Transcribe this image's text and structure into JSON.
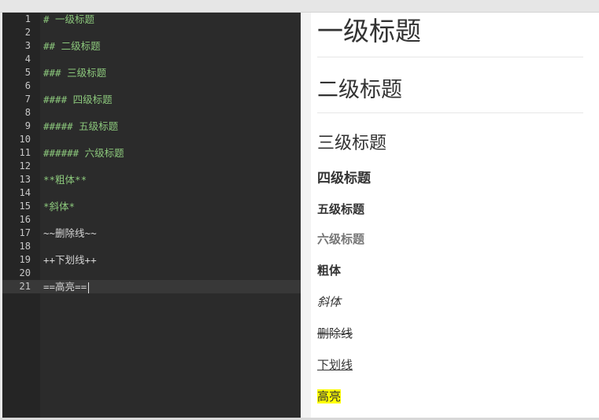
{
  "editor": {
    "lines": [
      {
        "n": "1",
        "text": "# 一级标题"
      },
      {
        "n": "2",
        "text": ""
      },
      {
        "n": "3",
        "text": "## 二级标题"
      },
      {
        "n": "4",
        "text": ""
      },
      {
        "n": "5",
        "text": "### 三级标题"
      },
      {
        "n": "6",
        "text": ""
      },
      {
        "n": "7",
        "text": "#### 四级标题"
      },
      {
        "n": "8",
        "text": ""
      },
      {
        "n": "9",
        "text": "##### 五级标题"
      },
      {
        "n": "10",
        "text": ""
      },
      {
        "n": "11",
        "text": "###### 六级标题"
      },
      {
        "n": "12",
        "text": ""
      },
      {
        "n": "13",
        "text": "**粗体**"
      },
      {
        "n": "14",
        "text": ""
      },
      {
        "n": "15",
        "text": "*斜体*"
      },
      {
        "n": "16",
        "text": ""
      },
      {
        "n": "17",
        "text": "~~删除线~~"
      },
      {
        "n": "18",
        "text": ""
      },
      {
        "n": "19",
        "text": "++下划线++"
      },
      {
        "n": "20",
        "text": ""
      },
      {
        "n": "21",
        "text": "==高亮=="
      }
    ],
    "active_line": "21"
  },
  "preview": {
    "h1": "一级标题",
    "h2": "二级标题",
    "h3": "三级标题",
    "h4": "四级标题",
    "h5": "五级标题",
    "h6": "六级标题",
    "bold": "粗体",
    "italic": "斜体",
    "strike": "删除线",
    "underline": "下划线",
    "highlight": "高亮"
  },
  "colors": {
    "editor_bg": "#2b2b2b",
    "gutter_bg": "#252525",
    "code_green": "#8cc87c",
    "highlight": "#ffff00"
  }
}
